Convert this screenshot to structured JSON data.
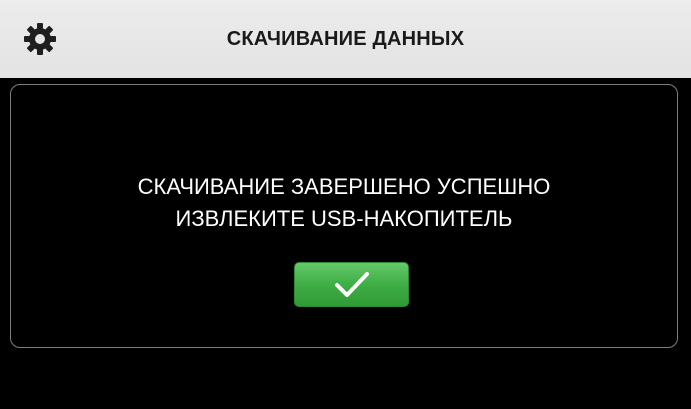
{
  "header": {
    "title": "СКАЧИВАНИЕ ДАННЫХ",
    "settings_icon": "gear-icon"
  },
  "dialog": {
    "line1": "СКАЧИВАНИЕ ЗАВЕРШЕНО УСПЕШНО",
    "line2": "ИЗВЛЕКИТЕ USB-НАКОПИТЕЛЬ",
    "confirm_icon": "checkmark-icon"
  },
  "colors": {
    "header_bg": "#e6e6e6",
    "screen_bg": "#000000",
    "text": "#ffffff",
    "confirm_green": "#3fae45"
  }
}
